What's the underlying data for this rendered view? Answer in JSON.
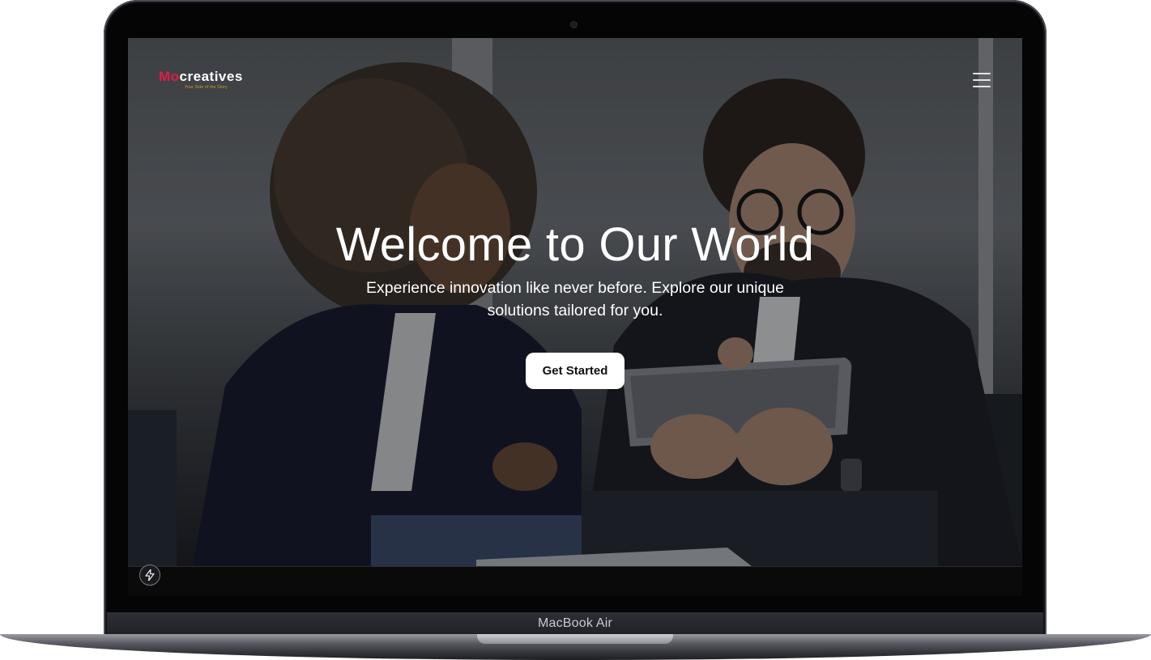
{
  "device": {
    "model_label": "MacBook Air"
  },
  "site": {
    "logo_prefix": "Mo",
    "logo_suffix": "creatives",
    "logo_tagline": "Your Side of the Story",
    "brand_color": "#e8194a"
  },
  "hero": {
    "title": "Welcome to Our World",
    "subtitle": "Experience innovation like never before. Explore our unique solutions tailored for you.",
    "cta_label": "Get Started"
  },
  "icons": {
    "menu": "hamburger-menu-icon",
    "bolt": "lightning-bolt-icon"
  }
}
